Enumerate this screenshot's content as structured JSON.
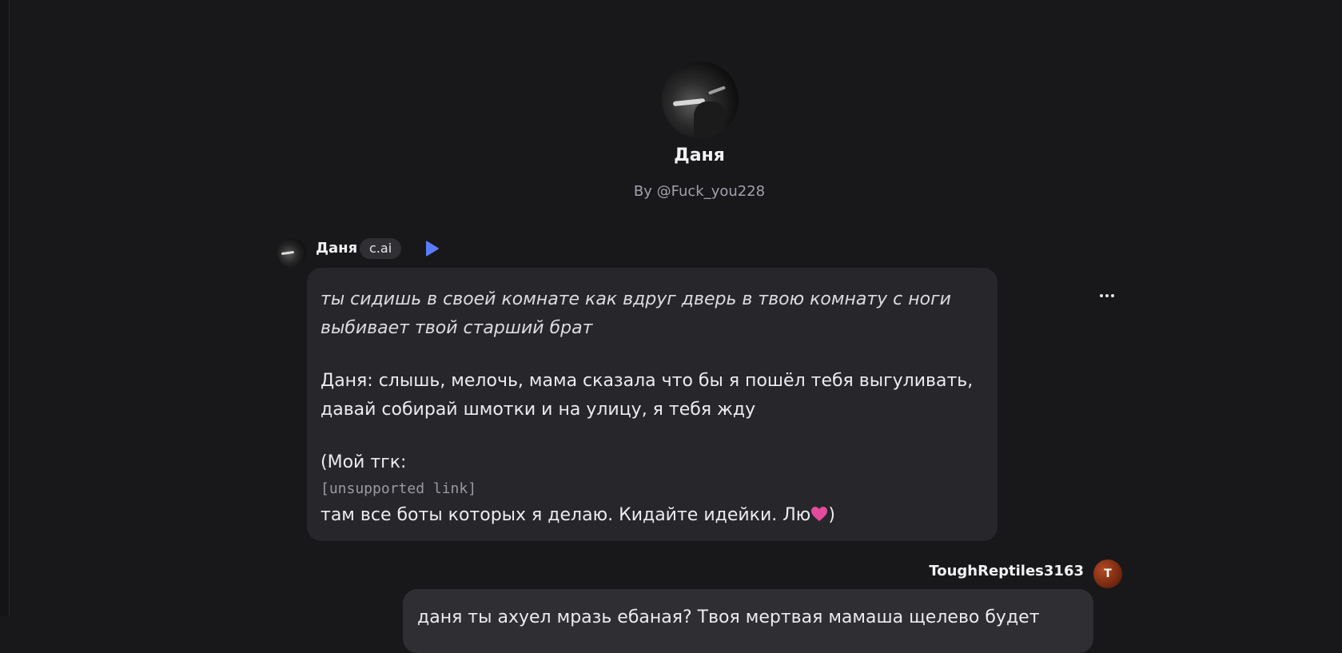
{
  "character": {
    "name": "Даня",
    "author": "By @Fuck_you228"
  },
  "message_ai": {
    "sender": "Даня",
    "badge": "c.ai",
    "line_italic": "ты сидишь в своей комнате как вдруг дверь в твою комнату с ноги выбивает твой старший брат",
    "line_speech": "Даня: слышь, мелочь, мама сказала что бы я пошёл тебя выгуливать, давай собирай шмотки и на улицу, я тебя жду",
    "line_tg": "(Мой тгк:",
    "link_text": "[unsupported link]",
    "line_end": " там все боты которых я делаю. Кидайте идейки. Лю",
    "line_end_close": ")"
  },
  "message_user": {
    "sender": "ToughReptiles3163",
    "avatar_letter": "T",
    "text": "даня ты ахуел мразь ебаная? Твоя мертвая мамаша щелево будет"
  },
  "colors": {
    "background": "#18181b",
    "bubble_ai": "#26262b",
    "bubble_user": "#2e2e33",
    "play_accent": "#5b7cfa",
    "heart": "#e44b9a"
  },
  "icons": {
    "play": "play-icon",
    "more": "more-horizontal-icon",
    "heart": "pink-heart-emoji"
  }
}
